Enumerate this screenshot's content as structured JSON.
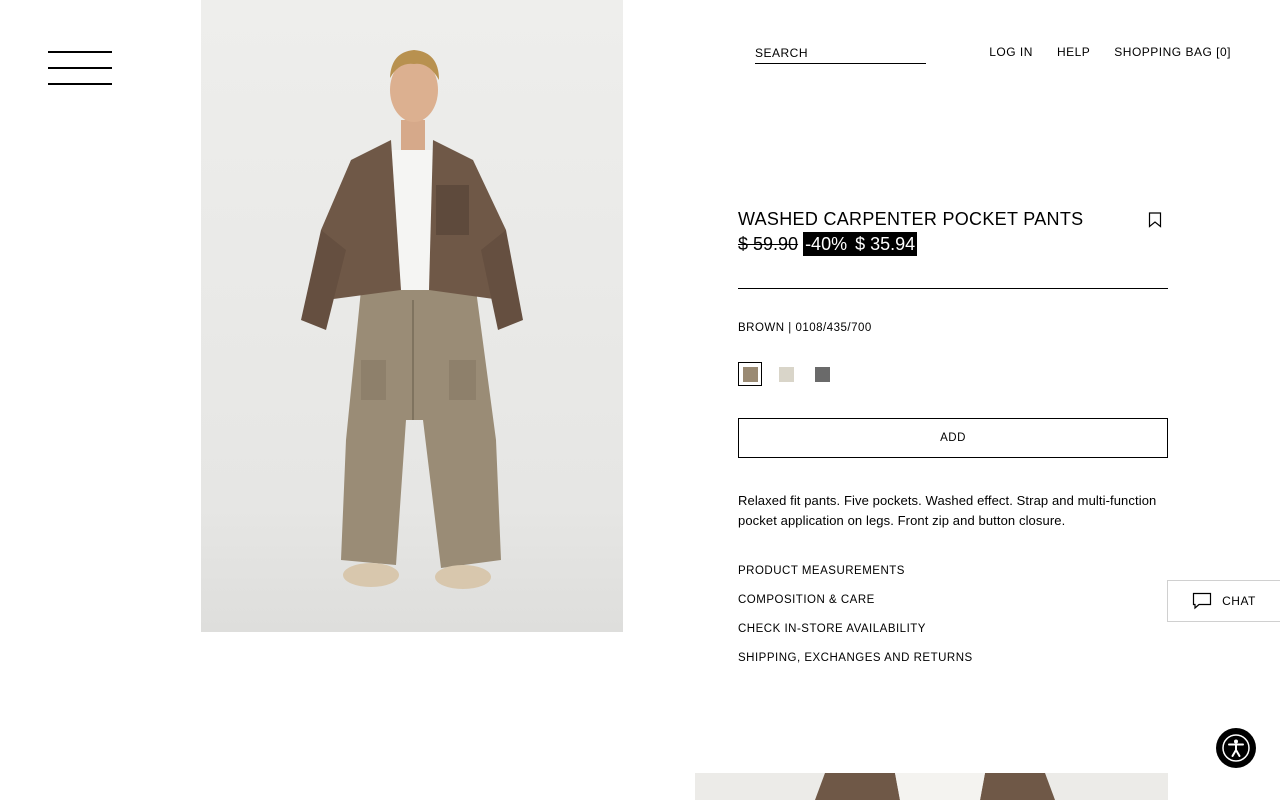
{
  "header": {
    "menu_icon": "hamburger-menu-icon",
    "search_placeholder": "SEARCH",
    "login": "LOG IN",
    "help": "HELP",
    "bag": "SHOPPING BAG [0]"
  },
  "product": {
    "title": "WASHED CARPENTER POCKET PANTS",
    "old_price": "$ 59.90",
    "discount": "-40%",
    "sale_price": "$ 35.94",
    "color_info": "BROWN | 0108/435/700",
    "swatches": [
      {
        "color": "#9a8a73",
        "selected": true
      },
      {
        "color": "#d9d5c9",
        "selected": false
      },
      {
        "color": "#6a6a6a",
        "selected": false
      }
    ],
    "add_label": "ADD",
    "description": "Relaxed fit pants. Five pockets. Washed effect. Strap and multi-function pocket application on legs. Front zip and button closure.",
    "links": [
      "PRODUCT MEASUREMENTS",
      "COMPOSITION & CARE",
      "CHECK IN-STORE AVAILABILITY",
      "SHIPPING, EXCHANGES AND RETURNS"
    ]
  },
  "chat": {
    "label": "CHAT",
    "icon": "chat-bubble-icon"
  },
  "accessibility": {
    "icon": "accessibility-icon"
  },
  "colors": {
    "sale_bg": "#000000",
    "jacket": "#6f5847",
    "pants": "#9a8c76"
  }
}
